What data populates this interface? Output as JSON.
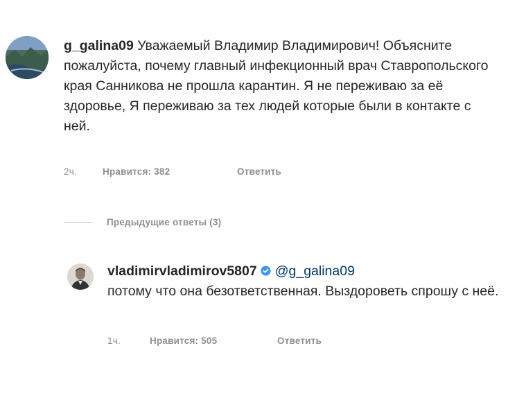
{
  "comment": {
    "username": "g_galina09",
    "text": "Уважаемый Владимир Владимирович! Объясните пожалуйста, почему главный инфекционный врач Ставропольского края Санникова не прошла карантин. Я не переживаю за её здоровье, Я переживаю за тех людей которые были в контакте с ней.",
    "time": "2ч.",
    "likes": "Нравится: 382",
    "reply_label": "Ответить"
  },
  "previous_replies": {
    "label": "Предыдущие ответы (3)"
  },
  "reply": {
    "username": "vladimirvladimirov5807",
    "mention": "@g_galina09",
    "text": "потому что она безответственная. Выздороветь спрошу с неё.",
    "time": "1ч.",
    "likes": "Нравится: 505",
    "reply_label": "Ответить"
  },
  "icons": {
    "verified": "verified-badge-icon",
    "verified_color": "#3897f0"
  },
  "colors": {
    "text": "#262626",
    "meta": "#8e8e8e",
    "mention": "#00376b"
  }
}
